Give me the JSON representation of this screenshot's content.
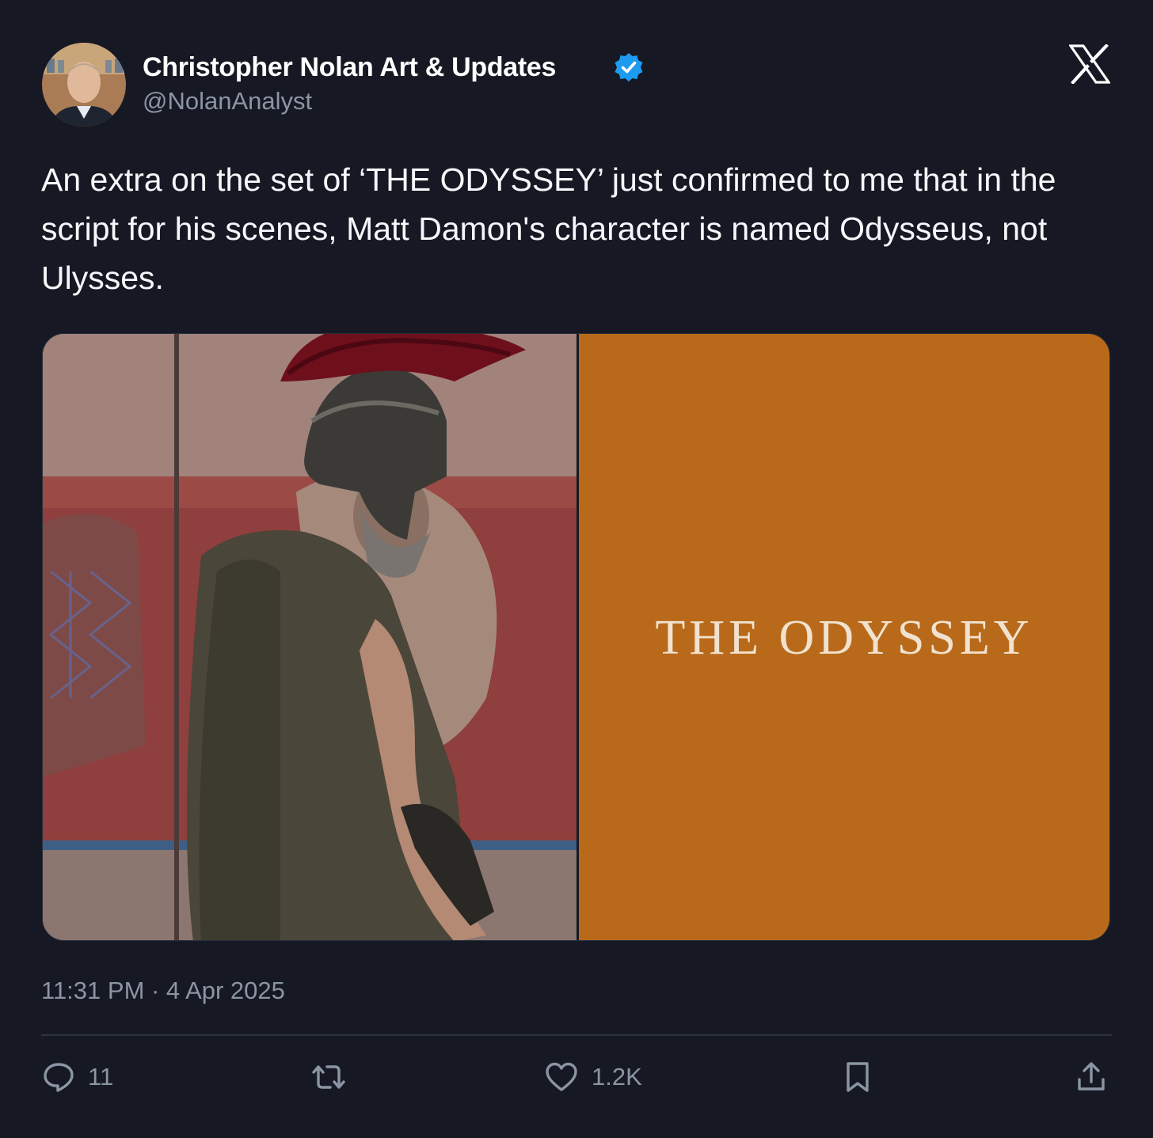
{
  "author": {
    "display_name": "Christopher Nolan Art & Updates",
    "handle": "@NolanAnalyst",
    "verified": true
  },
  "tweet": {
    "text": "An extra on the set of ‘THE ODYSSEY’ just confirmed to me that in the script for his scenes, Matt Damon's character is named Odysseus, not Ulysses.",
    "media": {
      "poster_title": "THE ODYSSEY"
    },
    "timestamp": "11:31 PM · 4 Apr 2025"
  },
  "actions": {
    "reply_count": "11",
    "like_count": "1.2K"
  },
  "colors": {
    "background": "#161923",
    "verified_blue": "#1d9bf0",
    "poster_orange": "#b86a1a",
    "muted_text": "#8b95a3"
  },
  "icons": [
    "x-logo-icon",
    "verified-badge-icon",
    "reply-icon",
    "retweet-icon",
    "like-icon",
    "bookmark-icon",
    "share-icon"
  ]
}
